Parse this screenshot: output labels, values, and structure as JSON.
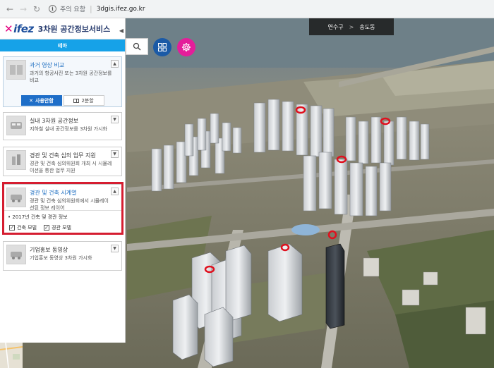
{
  "browser": {
    "back_icon": "arrow-left-icon",
    "forward_icon": "arrow-right-icon",
    "reload_icon": "reload-icon",
    "security_label": "주의 요함",
    "url": "3dgis.ifez.go.kr"
  },
  "app": {
    "logo_text": "ifez",
    "title": "3차원 공간정보서비스",
    "tab_label": "테마",
    "collapse_glyph": "◀"
  },
  "location": {
    "district": "연수구",
    "dong": "송도동"
  },
  "cards": [
    {
      "title": "과거 영상 비교",
      "desc": "과거의 항공사진 또는 3차원 공간정보를 비교",
      "toggle": "▲",
      "buttons": {
        "use": "사용안함",
        "split": "2분할"
      }
    },
    {
      "title": "실내 3차원 공간정보",
      "desc": "지하철 실내 공간정보를 3차원 가시화",
      "toggle": "▼"
    },
    {
      "title": "경관 및 건축 심의 업무 지원",
      "desc": "경관 및 건축 심의위원회 개최 시 시뮬레이션을 통한 업무 지원",
      "toggle": "▼"
    },
    {
      "title": "경관 및 건축 시계열",
      "desc": "경관 및 건축 심의위원회에서 시뮬레이션된 정보 레이어",
      "toggle": "▲",
      "sub_header": "2017년 건축 및 경관 정보",
      "checks": [
        "건축 모델",
        "경관 모델"
      ]
    },
    {
      "title": "기업홍보 동영상",
      "desc": "기업홍보 동영상 3차원 가시화",
      "toggle": "▼"
    }
  ],
  "colors": {
    "accent_blue": "#16a2e8",
    "highlight_red": "#d51d30",
    "tool_blue": "#1b5aa6",
    "tool_pink": "#e41e9a"
  },
  "icons": {
    "search": "search-icon",
    "grid": "grid-icon",
    "settings": "gear-icon"
  }
}
